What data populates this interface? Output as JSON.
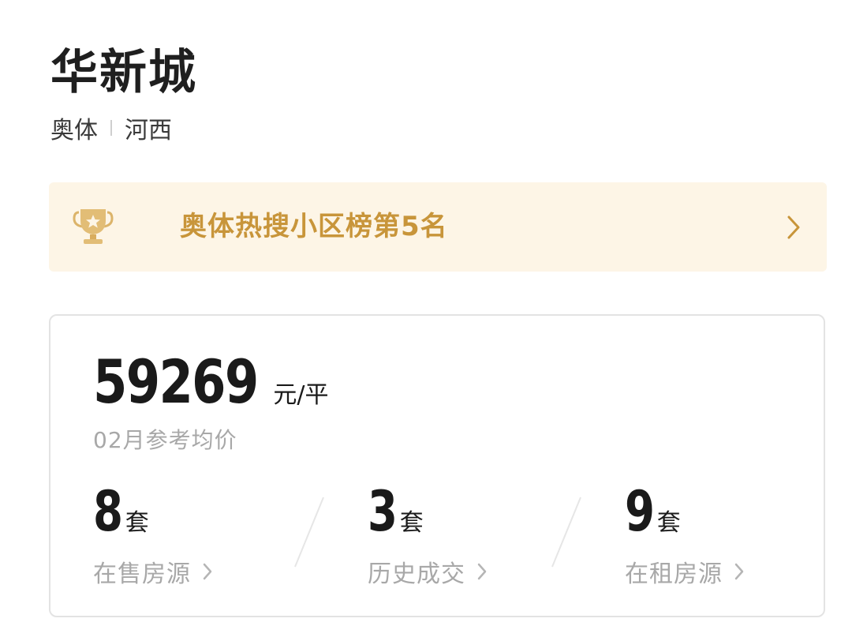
{
  "community": {
    "name": "华新城",
    "district": "奥体",
    "area": "河西"
  },
  "rank_banner": {
    "text": "奥体热搜小区榜第5名",
    "icon": "trophy-icon",
    "chevron": "chevron-right-icon"
  },
  "price": {
    "value": "59269",
    "unit": "元/平",
    "caption": "02月参考均价"
  },
  "stats": [
    {
      "count": "8",
      "unit": "套",
      "label": "在售房源"
    },
    {
      "count": "3",
      "unit": "套",
      "label": "历史成交"
    },
    {
      "count": "9",
      "unit": "套",
      "label": "在租房源"
    }
  ],
  "colors": {
    "accent_gold": "#c8953a",
    "banner_bg": "#fdf5e6",
    "muted_text": "#a8a8a8",
    "card_border": "#e3e3e3"
  }
}
